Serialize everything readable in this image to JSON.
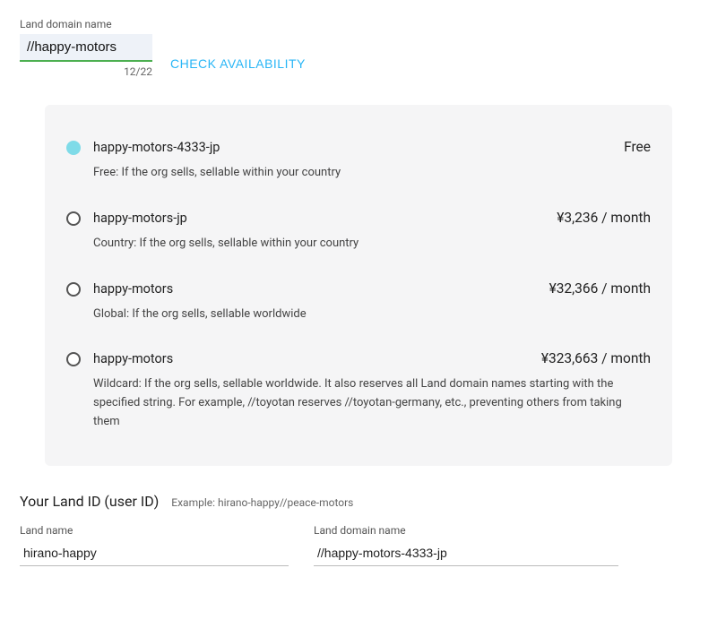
{
  "top": {
    "label": "Land domain name",
    "value": "//happy-motors",
    "counter": "12/22",
    "check_label": "CHECK AVAILABILITY"
  },
  "options": [
    {
      "name": "happy-motors-4333-jp",
      "price": "Free",
      "desc": "Free: If the org sells, sellable within your country",
      "selected": true
    },
    {
      "name": "happy-motors-jp",
      "price": "¥3,236 / month",
      "desc": "Country: If the org sells, sellable within your country",
      "selected": false
    },
    {
      "name": "happy-motors",
      "price": "¥32,366 / month",
      "desc": "Global: If the org sells, sellable worldwide",
      "selected": false
    },
    {
      "name": "happy-motors",
      "price": "¥323,663 / month",
      "desc": "Wildcard: If the org sells, sellable worldwide. It also reserves all Land domain names starting with the specified string. For example, //toyotan reserves //toyotan-germany, etc., preventing others from taking them",
      "selected": false
    }
  ],
  "landid": {
    "title": "Your Land ID (user ID)",
    "example": "Example: hirano-happy//peace-motors",
    "land_name_label": "Land name",
    "land_name_value": "hirano-happy",
    "domain_label": "Land domain name",
    "domain_value": "//happy-motors-4333-jp"
  }
}
